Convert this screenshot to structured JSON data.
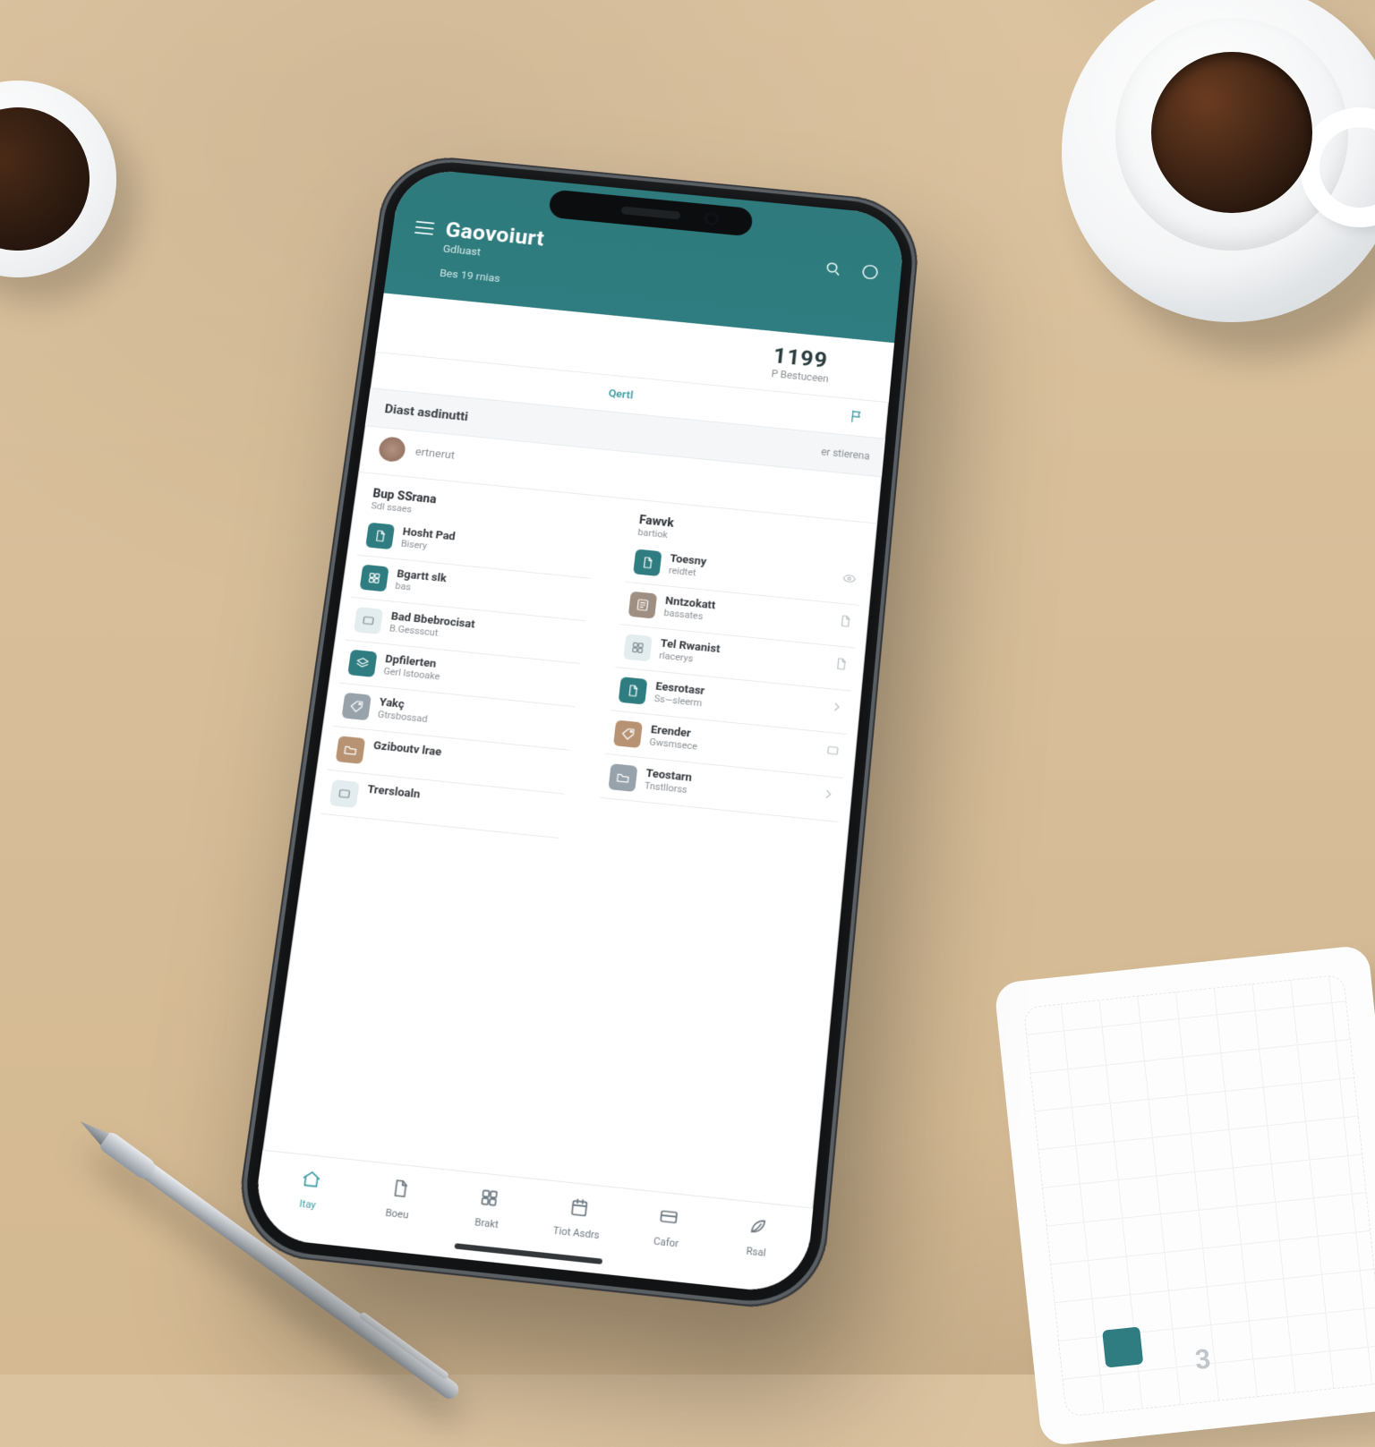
{
  "header": {
    "app_title": "Gaovoiurt",
    "sub_label": "Gdluast",
    "meta_line": "Bes 19 rnias",
    "count": "1199",
    "count_sub": "P Bestuceen"
  },
  "quick": {
    "label": "Qertl"
  },
  "section": {
    "title": "Diast asdinutti",
    "sub": "er stierena"
  },
  "profile": {
    "label": "ertnerut"
  },
  "left_header": {
    "title": "Bup SSrana",
    "sub": "Sdl ssaes"
  },
  "right_header": {
    "title": "Fawvk",
    "sub": "bartiok"
  },
  "left_items": [
    {
      "title": "Hosht Pad",
      "sub": "Bisery",
      "tile": "teal",
      "icon": "doc"
    },
    {
      "title": "Bgartt slk",
      "sub": "bas",
      "tile": "teal",
      "icon": "grid"
    },
    {
      "title": "Bad Bbebrocisat",
      "sub": "B.Gessscut",
      "tile": "soft",
      "icon": "box"
    },
    {
      "title": "Dpfilerten",
      "sub": "Gerl lstooake",
      "tile": "teal",
      "icon": "layers"
    },
    {
      "title": "Yakç",
      "sub": "Gtrsbossad",
      "tile": "gray",
      "icon": "tag"
    },
    {
      "title": "Gziboutv lrae",
      "sub": "",
      "tile": "brown",
      "icon": "folder"
    },
    {
      "title": "Trersloaln",
      "sub": "",
      "tile": "soft",
      "icon": "box"
    }
  ],
  "right_items": [
    {
      "title": "Toesny",
      "sub": "reidtet",
      "tile": "teal",
      "icon": "doc",
      "trail": "eye"
    },
    {
      "title": "Nntzokatt",
      "sub": "bassates",
      "tile": "neutral",
      "icon": "sheet",
      "trail": "doc"
    },
    {
      "title": "Tel Rwanist",
      "sub": "rlacerys",
      "tile": "soft",
      "icon": "grid",
      "trail": "doc"
    },
    {
      "title": "Eesrotasr",
      "sub": "Ss—sleerm",
      "tile": "teal",
      "icon": "doc",
      "trail": "chev"
    },
    {
      "title": "Erender",
      "sub": "Gwsmsece",
      "tile": "brown",
      "icon": "tag",
      "trail": "box"
    },
    {
      "title": "Teostarn",
      "sub": "Tnstllorss",
      "tile": "gray",
      "icon": "folder",
      "trail": "chev"
    }
  ],
  "nav": {
    "items": [
      {
        "label": "Itay",
        "icon": "home"
      },
      {
        "label": "Boeu",
        "icon": "doc"
      },
      {
        "label": "Brakt",
        "icon": "grid"
      },
      {
        "label": "Tiot Asdrs",
        "icon": "calendar"
      },
      {
        "label": "Cafor",
        "icon": "card"
      },
      {
        "label": "Rsal",
        "icon": "leaf"
      }
    ],
    "active_index": 0
  },
  "colors": {
    "teal": "#2f7d80",
    "accent": "#3e9ca0"
  }
}
